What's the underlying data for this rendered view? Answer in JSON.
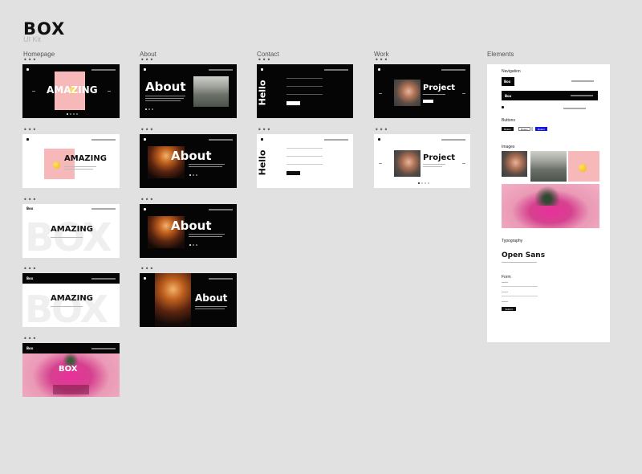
{
  "header": {
    "title": "BOX",
    "subtitle": "UI Kit"
  },
  "columns": {
    "homepage": "Homepage",
    "about": "About",
    "contact": "Contact",
    "work": "Work",
    "elements": "Elements"
  },
  "menu_dots": "•••",
  "homepage": {
    "amazing": "AMAZING",
    "box": "BOX",
    "logo": "Box"
  },
  "about": {
    "heading": "About"
  },
  "contact": {
    "heading": "Hello"
  },
  "work": {
    "heading": "Project"
  },
  "elements": {
    "navigation": "Navigation",
    "nav_logo": "Box",
    "buttons": "Buttons",
    "button_1": "Button",
    "button_2": "Button",
    "button_3": "Button",
    "images": "Images",
    "typography": "Typography",
    "font_name": "Open Sans",
    "form": "Form",
    "form_submit": "Submit"
  },
  "colors": {
    "dark": "#050505",
    "background": "#e1e1e1",
    "pink": "#f6b8b9",
    "accent_blue": "#1515e0"
  }
}
